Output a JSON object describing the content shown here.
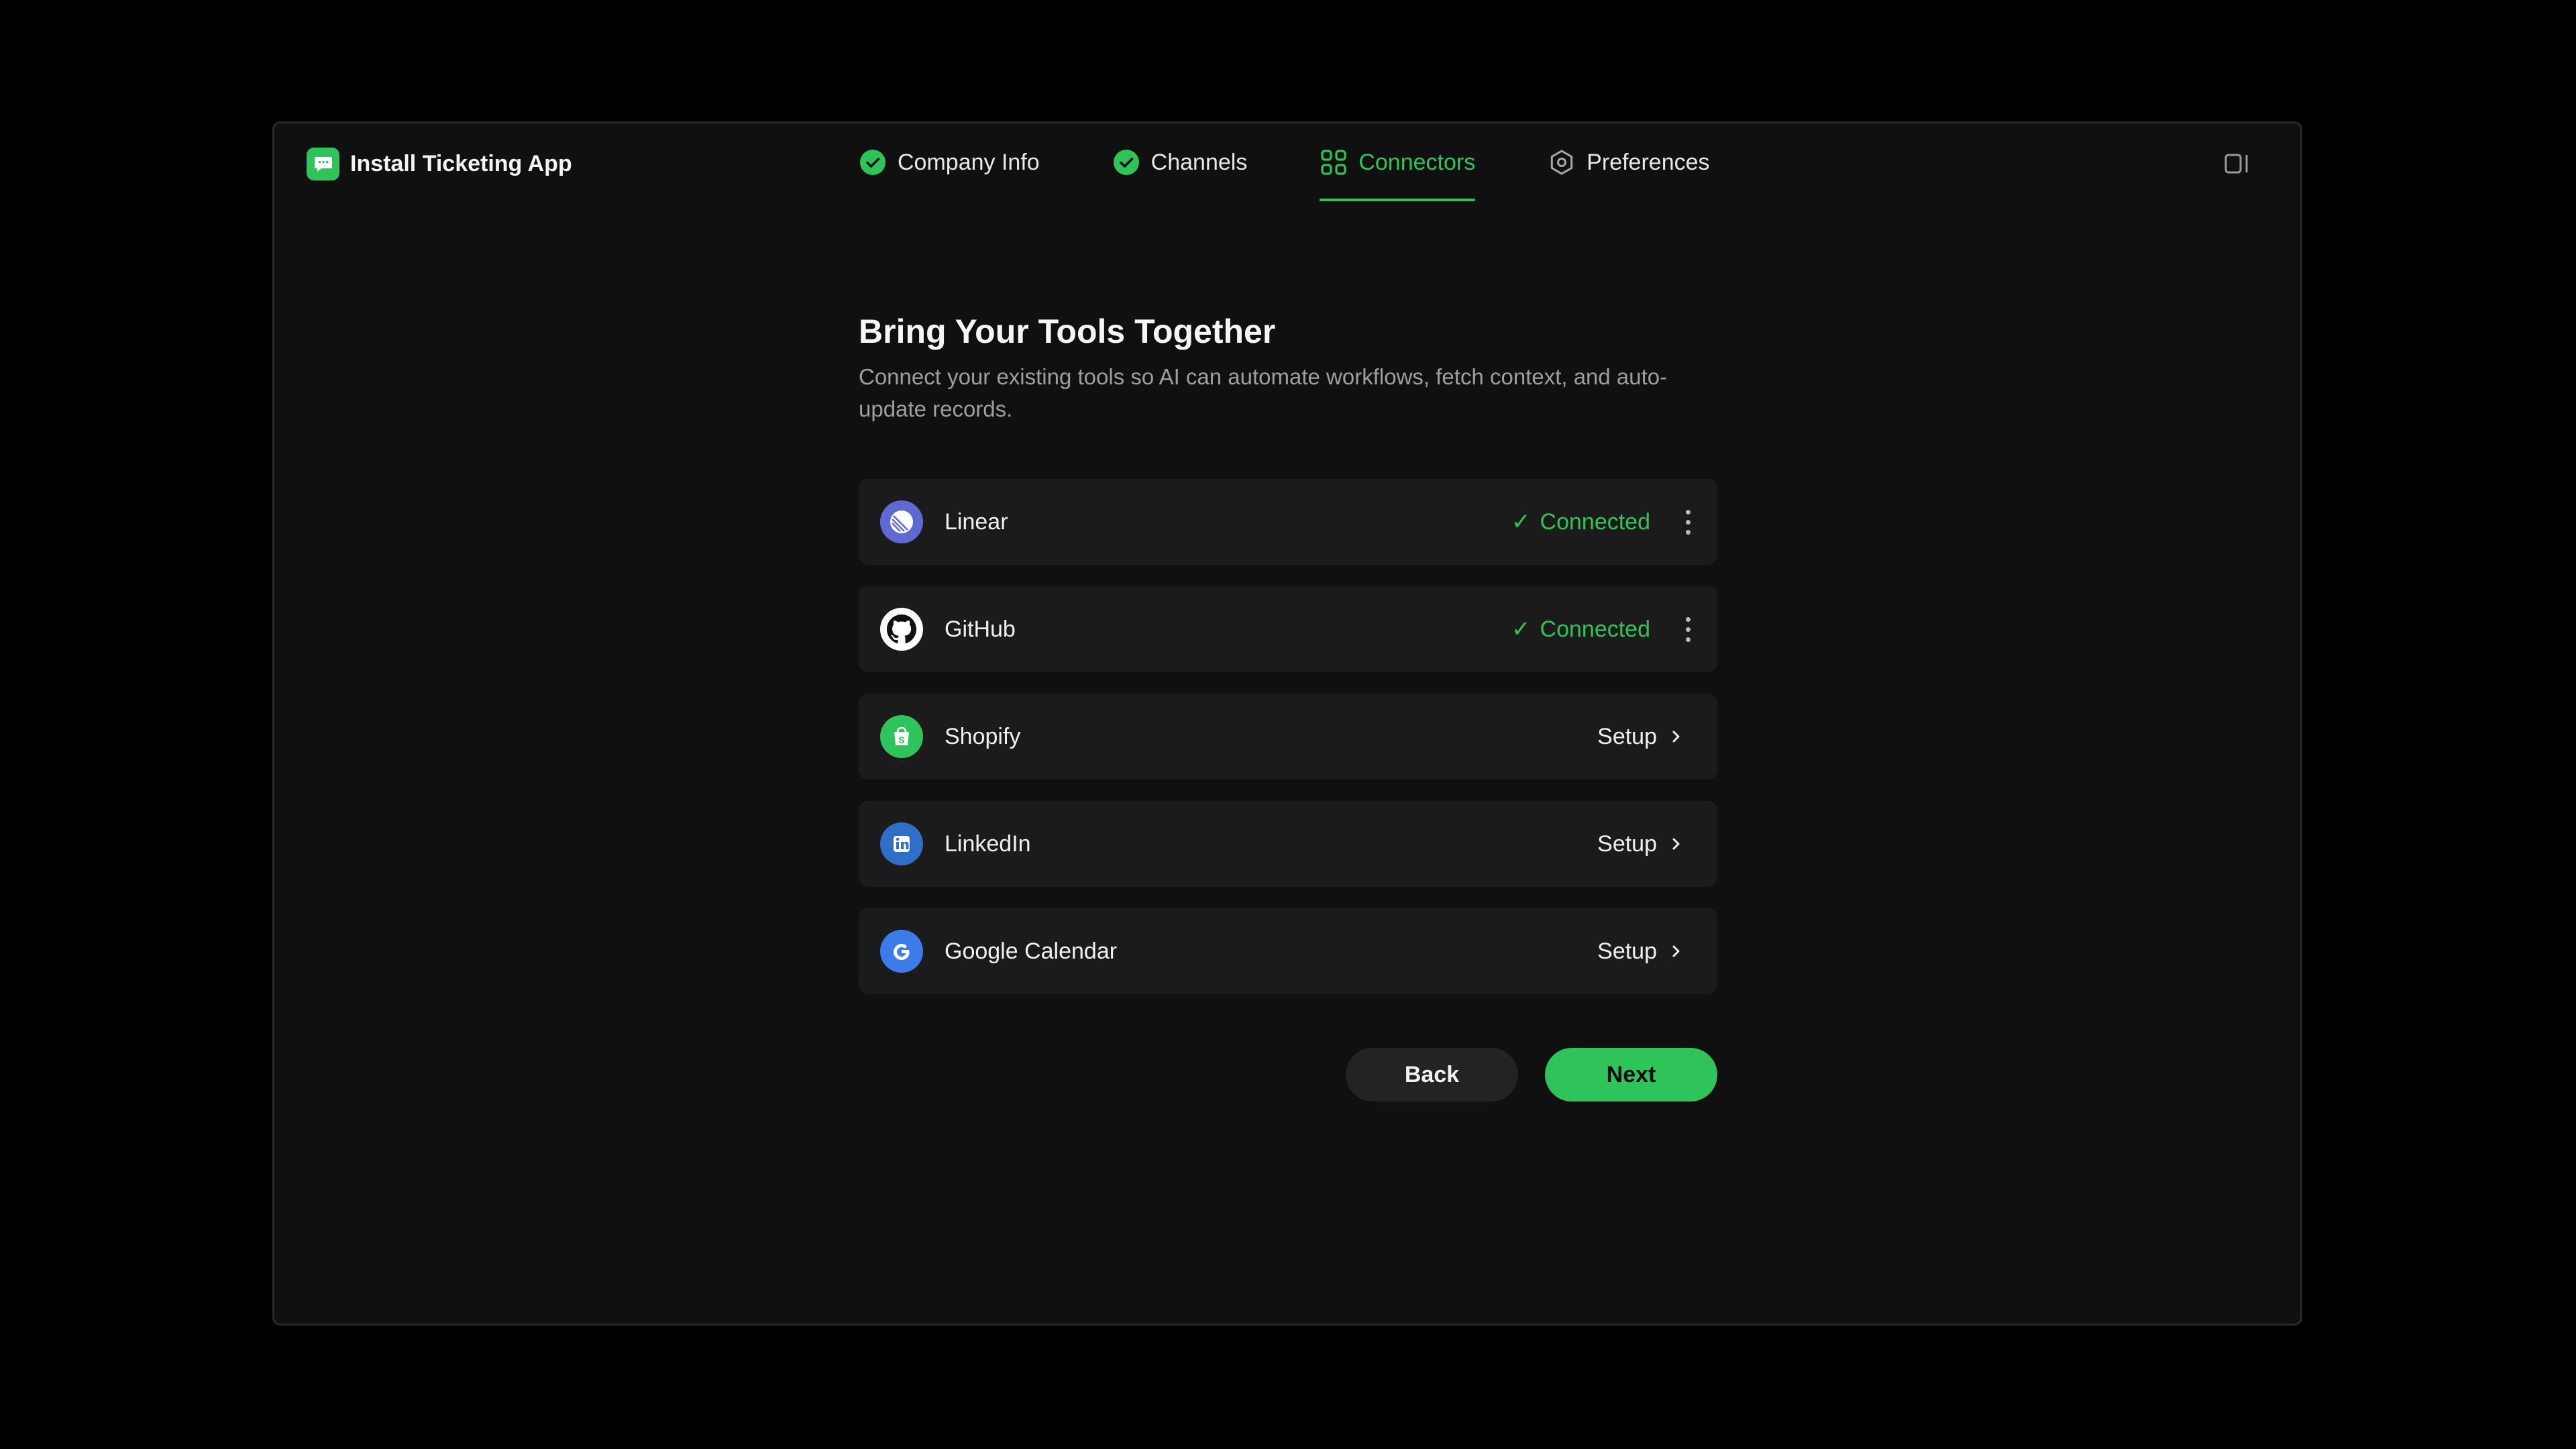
{
  "app": {
    "title": "Install Ticketing App",
    "accent_color": "#2fc45a",
    "logo_icon": "chat-bubble-icon"
  },
  "steps": [
    {
      "label": "Company Info",
      "state": "completed",
      "icon": "check-circle-icon"
    },
    {
      "label": "Channels",
      "state": "completed",
      "icon": "check-circle-icon"
    },
    {
      "label": "Connectors",
      "state": "active",
      "icon": "grid-icon"
    },
    {
      "label": "Preferences",
      "state": "pending",
      "icon": "hexagon-settings-icon"
    }
  ],
  "header": {
    "panel_toggle_icon": "sidebar-panel-icon"
  },
  "main": {
    "heading": "Bring Your Tools Together",
    "subtitle": "Connect your existing tools so AI can automate workflows, fetch context, and auto-update records."
  },
  "connectors": [
    {
      "name": "Linear",
      "status": "Connected",
      "action": "menu",
      "icon": "linear-icon",
      "icon_color": "#5e6ad2"
    },
    {
      "name": "GitHub",
      "status": "Connected",
      "action": "menu",
      "icon": "github-icon",
      "icon_color": "#ffffff"
    },
    {
      "name": "Shopify",
      "status": "Setup",
      "action": "setup",
      "icon": "shopify-icon",
      "icon_color": "#2fc45a"
    },
    {
      "name": "LinkedIn",
      "status": "Setup",
      "action": "setup",
      "icon": "linkedin-icon",
      "icon_color": "#2f6fc8"
    },
    {
      "name": "Google Calendar",
      "status": "Setup",
      "action": "setup",
      "icon": "google-icon",
      "icon_color": "#3b7bea"
    }
  ],
  "footer": {
    "back_label": "Back",
    "next_label": "Next"
  }
}
